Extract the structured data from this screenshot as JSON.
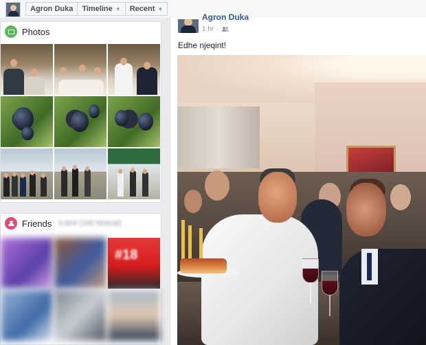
{
  "topbar": {
    "profile_name": "Agron Duka",
    "nav": [
      {
        "label": "Timeline"
      },
      {
        "label": "Recent"
      }
    ]
  },
  "photos": {
    "title": "Photos"
  },
  "friends": {
    "title": "Friends",
    "count_blurred": "4,904 (160 Mutual)",
    "tile3_badge": "#18"
  },
  "post": {
    "author": "Agron Duka",
    "time": "1 hr",
    "text": "Edhe njeqint!"
  },
  "colors": {
    "link_blue": "#365899",
    "meta_grey": "#90949c",
    "photos_icon": "#5cb85c",
    "friends_icon": "#e04a75"
  }
}
